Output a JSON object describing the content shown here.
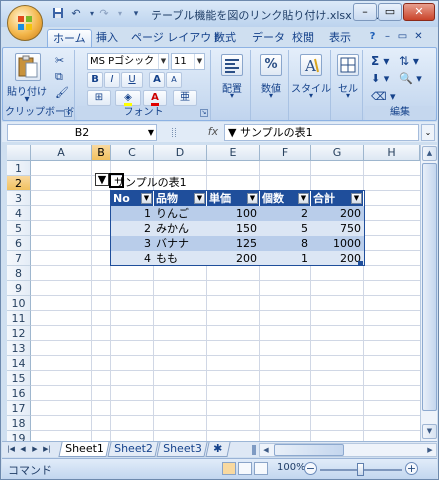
{
  "window": {
    "title": "テーブル機能を図のリンク貼り付け.xlsx - M...",
    "minimize": "–",
    "restore": "▭",
    "close": "✕"
  },
  "quick_access": {
    "save_icon": "floppy-icon",
    "undo_icon": "undo-icon",
    "redo_icon": "redo-icon"
  },
  "tabs": [
    "ホーム",
    "挿入",
    "ページ レイアウト",
    "数式",
    "データ",
    "校閲",
    "表示"
  ],
  "ribbon_controls": {
    "help": "?",
    "min": "–",
    "restore": "▭",
    "close": "✕"
  },
  "ribbon": {
    "clipboard": {
      "label": "クリップボード",
      "paste": "貼り付け"
    },
    "font": {
      "label": "フォント",
      "name": "MS Pゴシック",
      "size": "11",
      "bold": "B",
      "italic": "I",
      "underline": "U",
      "grow": "A",
      "shrink": "A",
      "color_letter": "A",
      "phonetic": "亜"
    },
    "alignment": {
      "label": "配置"
    },
    "number": {
      "label": "数値",
      "symbol": "%"
    },
    "styles": {
      "label": "スタイル"
    },
    "cells": {
      "label": "セル"
    },
    "editing": {
      "label": "編集"
    }
  },
  "formula_bar": {
    "name_box": "B2",
    "fx": "fx",
    "content": "▼ サンプルの表1"
  },
  "grid": {
    "columns": [
      "A",
      "B",
      "C",
      "D",
      "E",
      "F",
      "G",
      "H"
    ],
    "rows": [
      "1",
      "2",
      "3",
      "4",
      "5",
      "6",
      "7",
      "8",
      "9",
      "10",
      "11",
      "12",
      "13",
      "14",
      "15",
      "16",
      "17",
      "18",
      "19"
    ],
    "selected_column": "B",
    "selected_row": "2",
    "image_marker": "▼",
    "table_title": "サンプルの表1",
    "table": {
      "headers": [
        "No",
        "品物",
        "単価",
        "個数",
        "合計"
      ],
      "rows": [
        [
          "1",
          "りんご",
          "100",
          "2",
          "200"
        ],
        [
          "2",
          "みかん",
          "150",
          "5",
          "750"
        ],
        [
          "3",
          "バナナ",
          "125",
          "8",
          "1000"
        ],
        [
          "4",
          "もも",
          "200",
          "1",
          "200"
        ]
      ]
    }
  },
  "sheets": [
    "Sheet1",
    "Sheet2",
    "Sheet3"
  ],
  "active_sheet": "Sheet1",
  "status": {
    "mode": "コマンド",
    "zoom": "100%",
    "zoom_out": "−",
    "zoom_in": "+"
  }
}
